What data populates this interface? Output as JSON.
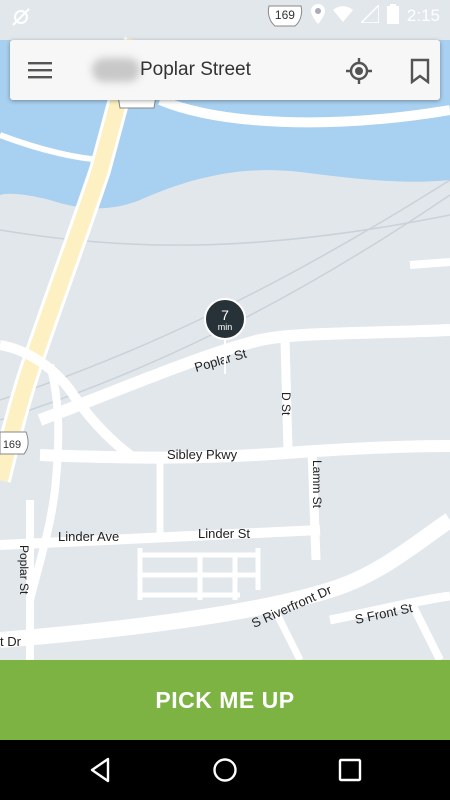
{
  "status_bar": {
    "time": "2:15",
    "route_shield": "169",
    "icons": [
      "gps-off-icon",
      "location-icon",
      "wifi-icon",
      "signal-icon",
      "battery-icon"
    ]
  },
  "search_bar": {
    "address": "Poplar Street",
    "menu_icon": "hamburger-menu-icon",
    "locate_icon": "my-location-icon",
    "bookmark_icon": "bookmark-icon"
  },
  "map": {
    "shield_label": "169",
    "street_labels": {
      "poplar_st_top": "Poplar St",
      "d_st": "D St",
      "sibley_pkwy": "Sibley Pkwy",
      "lamm_st": "Lamm St",
      "linder_ave": "Linder Ave",
      "linder_st": "Linder St",
      "poplar_st_left": "Poplar St",
      "s_riverfront_dr": "S Riverfront Dr",
      "s_front_st": "S Front St",
      "dr_partial": "t Dr"
    },
    "pickup_pin": {
      "eta_value": "7",
      "eta_unit": "min"
    },
    "colors": {
      "land": "#e2e7ec",
      "water": "#a8d0f0",
      "highway": "#fdf1c4",
      "road": "#ffffff"
    }
  },
  "action_button": {
    "label": "PICK ME UP",
    "color": "#7cb342"
  },
  "nav_bar": {
    "icons": [
      "back-icon",
      "home-icon",
      "recents-icon"
    ]
  }
}
